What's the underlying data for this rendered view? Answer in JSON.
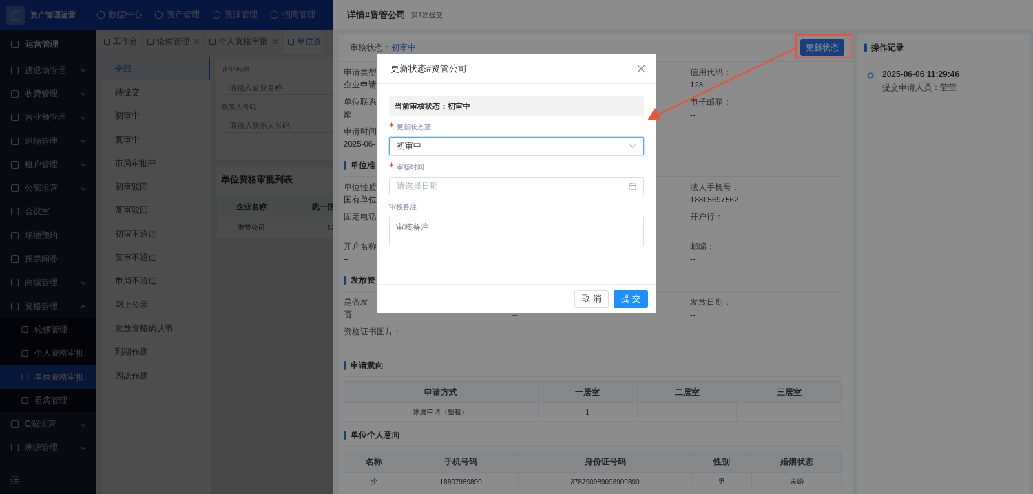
{
  "app": {
    "logo_title": "资产管理运营",
    "nav": [
      "数据中心",
      "资产管理",
      "资源管理",
      "招商管理"
    ]
  },
  "sidebar": {
    "section": "运营管理",
    "items": [
      {
        "label": "进退场管理",
        "expandable": true,
        "expanded": false
      },
      {
        "label": "收费管理",
        "expandable": true,
        "expanded": false
      },
      {
        "label": "营业额管理",
        "expandable": true,
        "expanded": false
      },
      {
        "label": "巡场管理",
        "expandable": true,
        "expanded": false
      },
      {
        "label": "租户管理",
        "expandable": true,
        "expanded": false
      },
      {
        "label": "公寓运营",
        "expandable": true,
        "expanded": false
      },
      {
        "label": "会议室",
        "expandable": false
      },
      {
        "label": "场地预约",
        "expandable": false
      },
      {
        "label": "投票问卷",
        "expandable": false
      },
      {
        "label": "商城管理",
        "expandable": true,
        "expanded": false
      },
      {
        "label": "资格管理",
        "expandable": true,
        "expanded": true,
        "children": [
          {
            "label": "轮候管理",
            "selected": false
          },
          {
            "label": "个人资格审批",
            "selected": false
          },
          {
            "label": "单位资格审批",
            "selected": true
          },
          {
            "label": "看房管理",
            "selected": false
          }
        ]
      },
      {
        "label": "C端运营",
        "expandable": true,
        "expanded": false
      },
      {
        "label": "溯源管理",
        "expandable": true,
        "expanded": false
      }
    ]
  },
  "tabs": [
    {
      "label": "工作台",
      "closable": false,
      "selected": false
    },
    {
      "label": "轮候管理",
      "closable": true,
      "selected": false
    },
    {
      "label": "个人资格审批",
      "closable": true,
      "selected": false
    },
    {
      "label": "单位资",
      "selected": true
    }
  ],
  "status_filter": [
    {
      "label": "全部",
      "selected": true
    },
    {
      "label": "待提交",
      "selected": false
    },
    {
      "label": "初审中",
      "selected": false
    },
    {
      "label": "复审中",
      "selected": false
    },
    {
      "label": "市局审批中",
      "selected": false
    },
    {
      "label": "初审驳回",
      "selected": false
    },
    {
      "label": "复审驳回",
      "selected": false
    },
    {
      "label": "初审不通过",
      "selected": false
    },
    {
      "label": "复审不通过",
      "selected": false
    },
    {
      "label": "市局不通过",
      "selected": false
    },
    {
      "label": "网上公示",
      "selected": false
    },
    {
      "label": "发放资格确认书",
      "selected": false
    },
    {
      "label": "到期作废",
      "selected": false
    },
    {
      "label": "因故作废",
      "selected": false
    }
  ],
  "filters": [
    {
      "label": "企业名称",
      "placeholder": "请输入企业名称"
    },
    {
      "label": "联系人号码",
      "placeholder": "请输入联系人号码"
    }
  ],
  "list": {
    "title": "单位资格审批列表",
    "columns": [
      "企业名称",
      "统一信"
    ],
    "rows": [
      [
        "资管公司",
        "12"
      ]
    ]
  },
  "drawer": {
    "title": "详情#资管公司",
    "subtitle": "第1次提交",
    "status_label": "审核状态：",
    "status_value": "初审中",
    "update_button": "更新状态",
    "blocks": [
      {
        "kind": "fields",
        "rows": [
          {
            "left": {
              "label": "申请类型",
              "value": "企业申请"
            },
            "right": {
              "label": "信用代码：",
              "value": "123"
            }
          },
          {
            "left": {
              "label": "单位联系",
              "value": "部"
            },
            "right": {
              "label": "电子邮箱：",
              "value": "--"
            }
          },
          {
            "left": {
              "label": "申请时间",
              "value": "2025-06-"
            }
          }
        ]
      },
      {
        "kind": "heading",
        "title": "单位准"
      },
      {
        "kind": "fields",
        "rows": [
          {
            "left": {
              "label": "单位性质",
              "value": "国有单位"
            },
            "right": {
              "label": "法人手机号：",
              "value": "18805697562"
            }
          },
          {
            "left": {
              "label": "固定电话",
              "value": "--"
            },
            "right": {
              "label": "开户行：",
              "value": "--"
            }
          },
          {
            "left": {
              "label": "开户名称",
              "value": "--"
            },
            "right": {
              "label": "邮编：",
              "value": "--"
            }
          }
        ]
      },
      {
        "kind": "heading",
        "title": "发放资"
      },
      {
        "kind": "fields",
        "rows": [
          {
            "left": {
              "label": "是否发",
              "value": "否"
            },
            "middle": {
              "value": "--"
            },
            "right": {
              "label": "发放日期：",
              "value": "--"
            }
          },
          {
            "left": {
              "label": "资格证书图片：",
              "value": "--"
            }
          }
        ]
      },
      {
        "kind": "heading",
        "title": "申请意向"
      },
      {
        "kind": "table",
        "columns": [
          "申请方式",
          "一居室",
          "二居室",
          "三居室"
        ],
        "rows": [
          [
            "家庭申请（整租）",
            "1",
            "",
            ""
          ]
        ]
      },
      {
        "kind": "heading",
        "title": "单位个人意向"
      },
      {
        "kind": "table",
        "columns": [
          "名称",
          "手机号码",
          "身份证号码",
          "性别",
          "婚姻状态"
        ],
        "rows": [
          [
            "少",
            "18807989890",
            "378790989098909890",
            "男",
            "未婚"
          ]
        ]
      }
    ]
  },
  "log": {
    "title": "操作记录",
    "entries": [
      {
        "time": "2025-06-06 11:29:46",
        "text": "提交申请人员：莹莹"
      }
    ]
  },
  "modal": {
    "title": "更新状态#资管公司",
    "current_status": "当前审核状态：初审中",
    "fields": [
      {
        "kind": "select",
        "label": "更新状态至",
        "required": true,
        "value": "初审中",
        "focused": true
      },
      {
        "kind": "date",
        "label": "审核时间",
        "required": true,
        "placeholder": "请选择日期",
        "focused": false
      },
      {
        "kind": "textarea",
        "label": "审核备注",
        "required": false,
        "placeholder": "审核备注",
        "focused": false
      }
    ],
    "buttons": [
      {
        "label": "取 消",
        "primary": false
      },
      {
        "label": "提 交",
        "primary": true
      }
    ]
  }
}
